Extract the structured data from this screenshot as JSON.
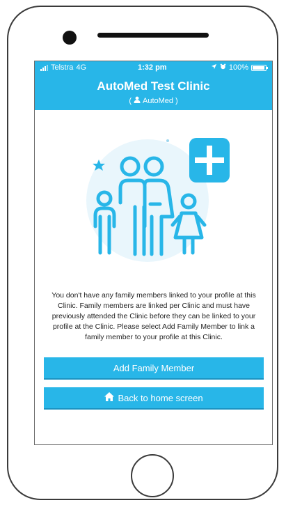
{
  "status_bar": {
    "carrier": "Telstra",
    "network": "4G",
    "time": "1:32 pm",
    "battery": "100%"
  },
  "header": {
    "title": "AutoMed Test Clinic",
    "subtitle_prefix": "(",
    "subtitle_user": "AutoMed",
    "subtitle_suffix": ")"
  },
  "main": {
    "illustration_icon": "family-add-icon",
    "message": "You don't have any family members linked to your profile at this Clinic. Family members are linked per Clinic and must have previously attended the Clinic before they can be linked to your profile at the Clinic. Please select Add Family Member to link a family member to your profile at this Clinic."
  },
  "buttons": {
    "add_family_member": "Add Family Member",
    "back_home": "Back to home screen"
  },
  "colors": {
    "accent": "#28b6e8",
    "accent_dark": "#1a93c2",
    "illustration_bg": "#e9f6fc"
  }
}
